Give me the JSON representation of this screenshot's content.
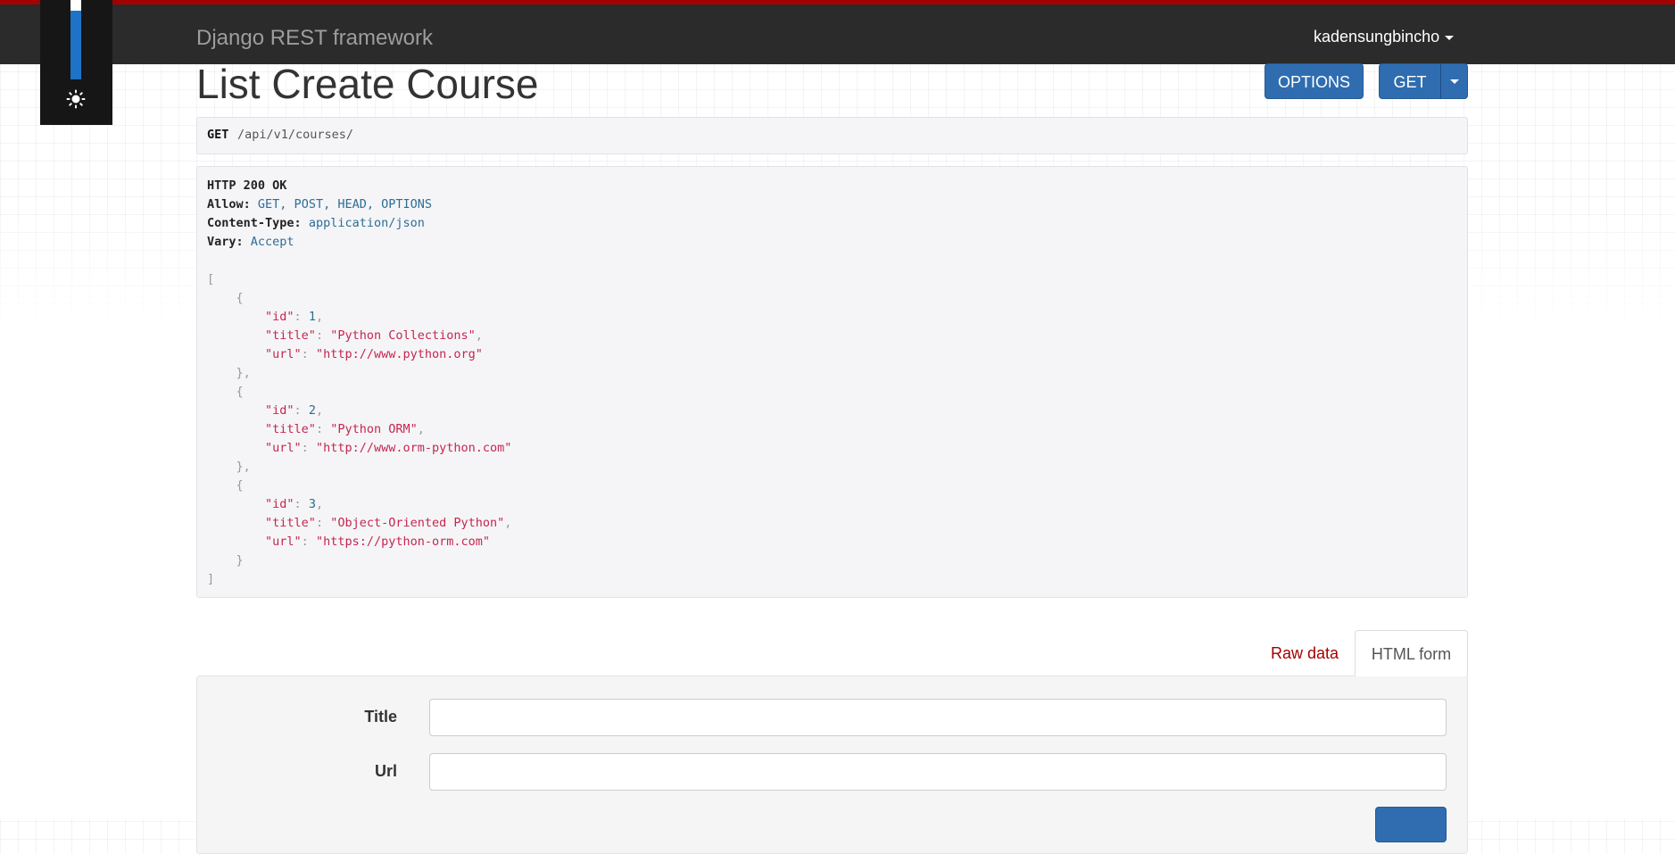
{
  "navbar": {
    "brand": "Django REST framework",
    "username": "kadensungbincho"
  },
  "theme_toggle": {
    "icon": "sun-icon"
  },
  "page": {
    "title": "List Create Course"
  },
  "buttons": {
    "options_label": "OPTIONS",
    "get_label": "GET"
  },
  "request": {
    "method": "GET",
    "path": "/api/v1/courses/"
  },
  "response": {
    "status": "HTTP 200 OK",
    "headers": [
      {
        "name": "Allow:",
        "value": "GET, POST, HEAD, OPTIONS"
      },
      {
        "name": "Content-Type:",
        "value": "application/json"
      },
      {
        "name": "Vary:",
        "value": "Accept"
      }
    ],
    "items": [
      {
        "id": "1",
        "title": "\"Python Collections\"",
        "url": "\"http://www.python.org\""
      },
      {
        "id": "2",
        "title": "\"Python ORM\"",
        "url": "\"http://www.orm-python.com\""
      },
      {
        "id": "3",
        "title": "\"Object-Oriented Python\"",
        "url": "\"https://python-orm.com\""
      }
    ]
  },
  "tabs": {
    "raw_data": "Raw data",
    "html_form": "HTML form"
  },
  "form": {
    "title_label": "Title",
    "url_label": "Url",
    "title_value": "",
    "url_value": ""
  },
  "colors": {
    "accent": "#a30000",
    "navbar": "#2b2b2b",
    "primary": "#2f6db0"
  }
}
